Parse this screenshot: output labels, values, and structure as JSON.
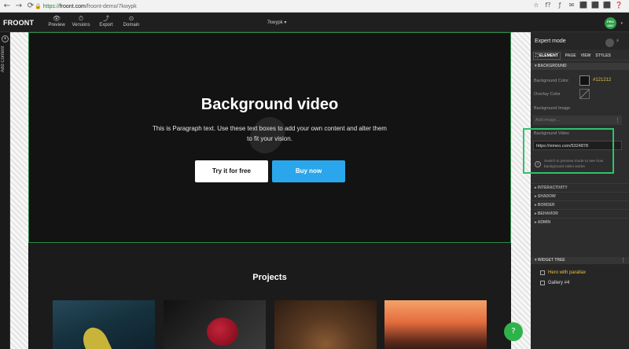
{
  "browser": {
    "back": "←",
    "forward": "→",
    "reload": "⟳",
    "url_secure": "https://",
    "url_host": "froont.com",
    "url_path": "/froont-demo/7kwypk",
    "ext": [
      "☆",
      "f?",
      "ƒ",
      "✉",
      "⬛",
      "⬛",
      "⬛",
      "❓"
    ]
  },
  "app": {
    "logo": "FROONT",
    "tools": [
      {
        "icon": "👁",
        "label": "Preview"
      },
      {
        "icon": "⏱",
        "label": "Versions"
      },
      {
        "icon": "⤴",
        "label": "Export"
      },
      {
        "icon": "⊙",
        "label": "Domain"
      }
    ],
    "page_name": "7kwypk ▾",
    "avatar": {
      "line1": "PRO",
      "line2": "ONT"
    },
    "avatar_caret": "▾"
  },
  "left_rail": {
    "plus": "+",
    "label": "Add Content"
  },
  "hero": {
    "title": "Background video",
    "paragraph": "This is Paragraph text. Use these text boxes to add your own content and alter them to fit your vision.",
    "btn_free": "Try it for free",
    "btn_buy": "Buy now"
  },
  "projects": {
    "title": "Projects"
  },
  "panel": {
    "expert_mode": "Expert mode",
    "bolt": "⚡",
    "tabs": [
      "⛶ ELEMENT",
      "PAGE",
      "VIEW",
      "STYLES"
    ],
    "background_section": "▾ BACKGROUND",
    "bg_color_label": "Background Color",
    "bg_color_value": "#121212",
    "overlay_label": "Overlay Color",
    "bg_image_label": "Background Image",
    "image_placeholder": "Add image...",
    "dots": "⋮",
    "video_label": "Background Video",
    "video_value": "https://vimeo.com/5324878",
    "info_icon": "i",
    "info_text": "Switch to preview mode to see how background video works",
    "collapsed": [
      "▸ INTERACTIVITY",
      "▸ SHADOW",
      "▸ BORDER",
      "▸ BEHAVIOR",
      "▸ ADMIN"
    ],
    "tree_head": "▾ WIDGET TREE",
    "tree_menu": "⋮",
    "tree_items": [
      "Hero with parallax",
      "Gallery #4"
    ]
  },
  "chat_icon": "?"
}
